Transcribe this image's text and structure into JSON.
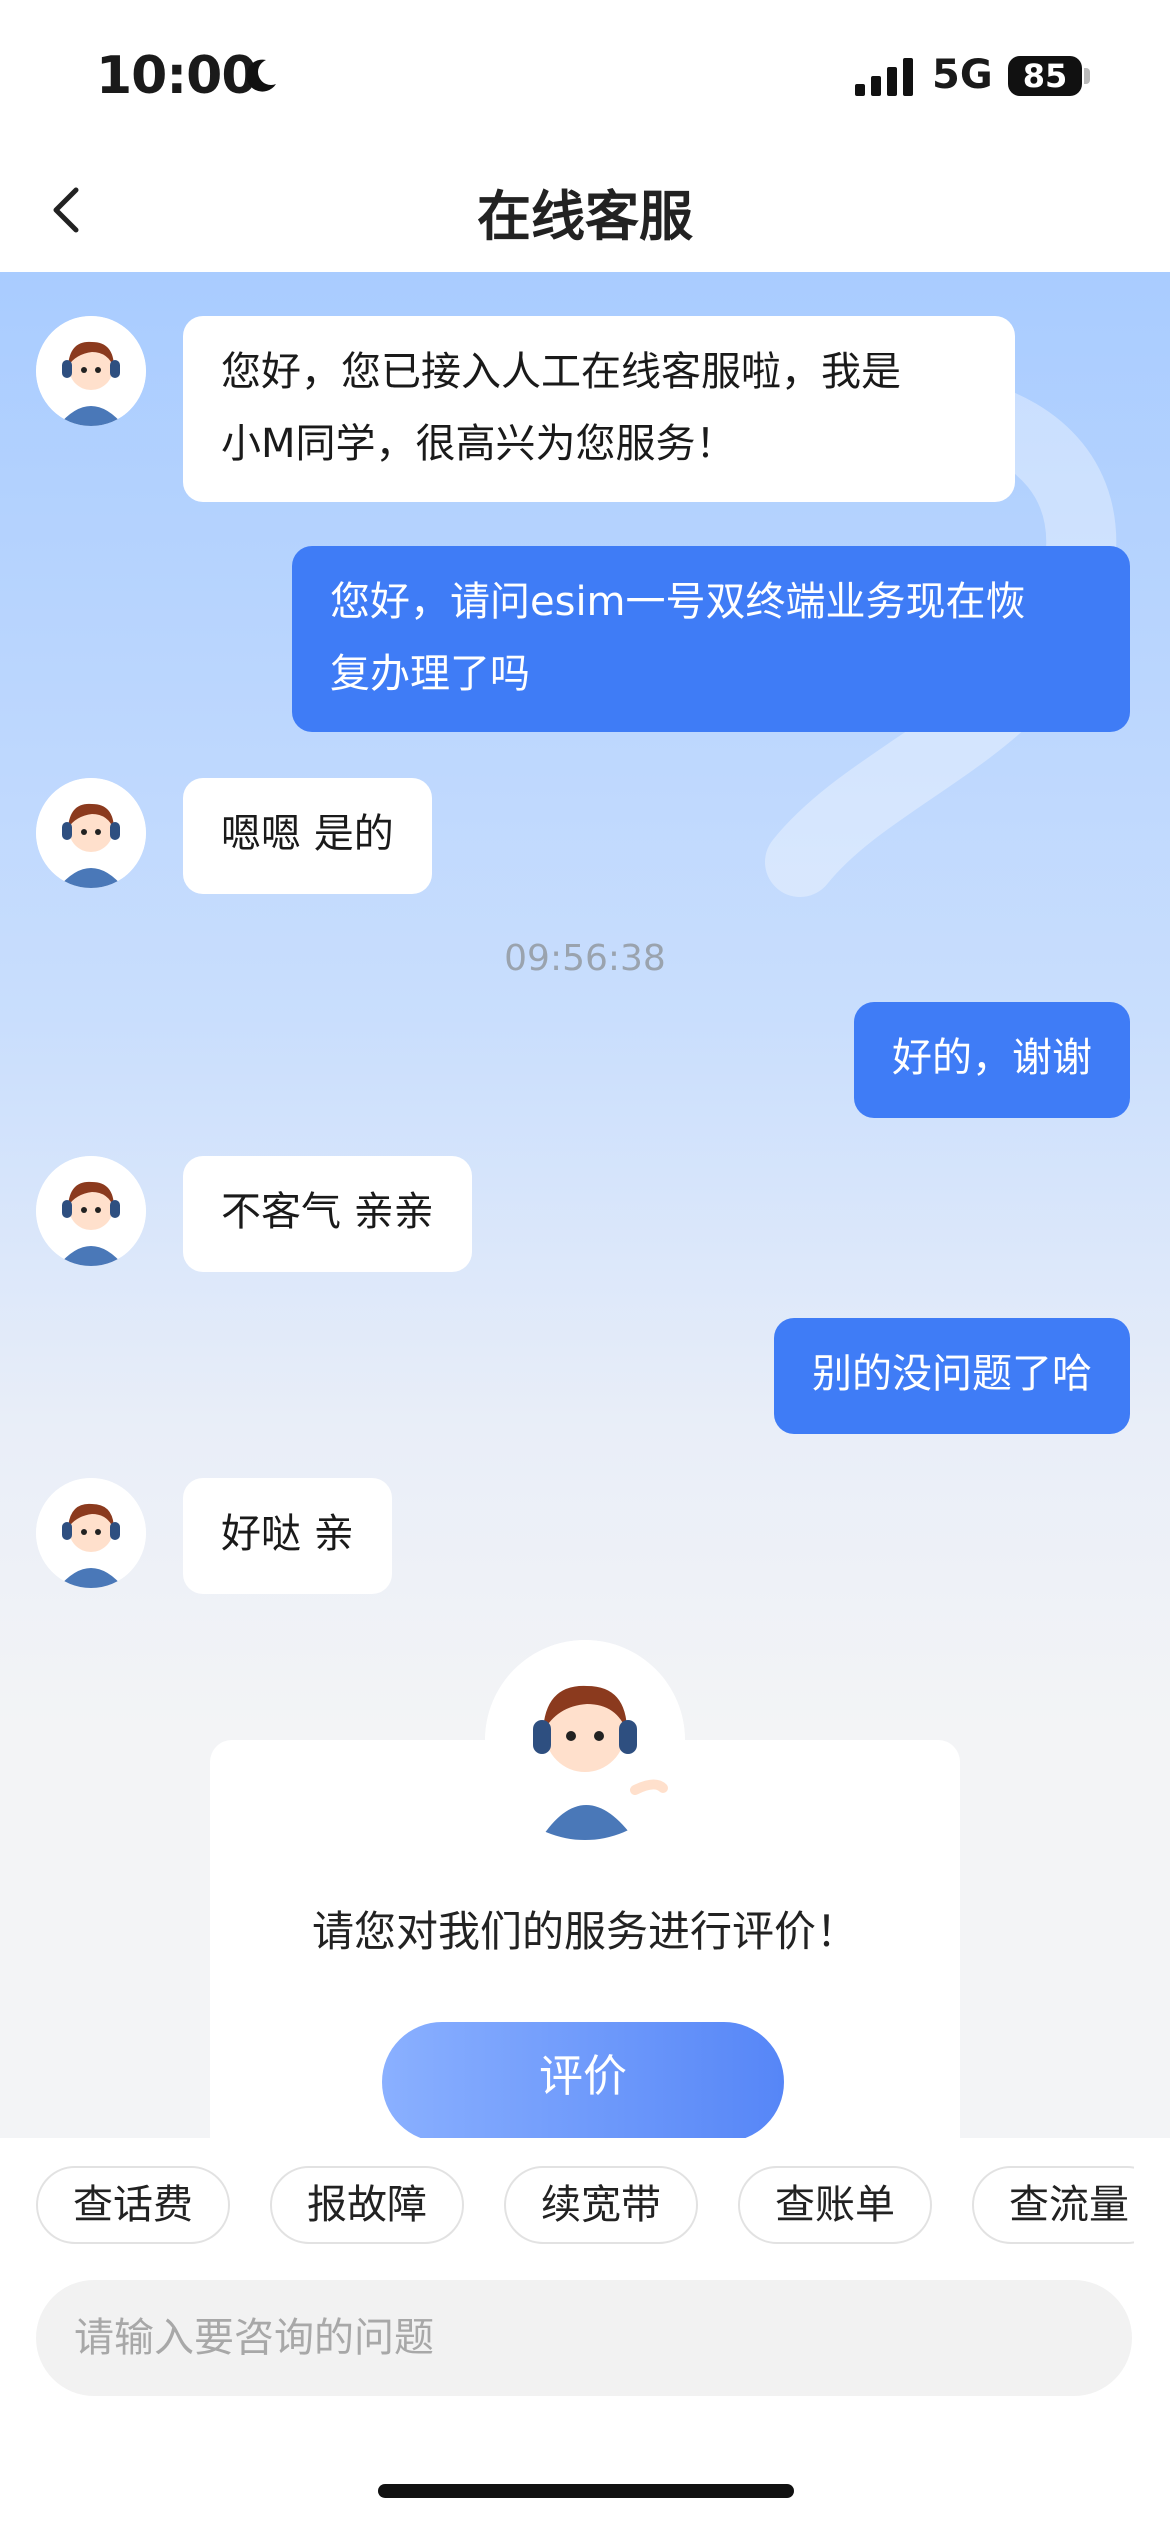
{
  "status": {
    "time": "10:00",
    "network": "5G",
    "battery": "85"
  },
  "header": {
    "title": "在线客服"
  },
  "messages": [
    {
      "from": "agent",
      "line1": "您好，您已接入人工在线客服啦，我是",
      "line2": "小M同学，很高兴为您服务！"
    },
    {
      "from": "user",
      "line1": "您好，请问esim一号双终端业务现在恢",
      "line2": "复办理了吗"
    },
    {
      "from": "agent",
      "text": "嗯嗯 是的"
    },
    {
      "from": "user",
      "text": "好的，谢谢"
    },
    {
      "from": "agent",
      "text": "不客气 亲亲"
    },
    {
      "from": "user",
      "text": "别的没问题了哈"
    },
    {
      "from": "agent",
      "text": "好哒 亲"
    }
  ],
  "timestamp": "09:56:38",
  "rating": {
    "prompt": "请您对我们的服务进行评价！",
    "button": "评价"
  },
  "quick_chips": [
    "查话费",
    "报故障",
    "续宽带",
    "查账单",
    "查流量"
  ],
  "input": {
    "placeholder": "请输入要咨询的问题"
  },
  "colors": {
    "accent": "#3f7cf6",
    "chat_top": "#a9ccff",
    "chat_bottom": "#f3f4f6"
  },
  "icons": [
    "back-arrow-icon",
    "moon-icon",
    "signal-icon",
    "agent-avatar-icon"
  ]
}
